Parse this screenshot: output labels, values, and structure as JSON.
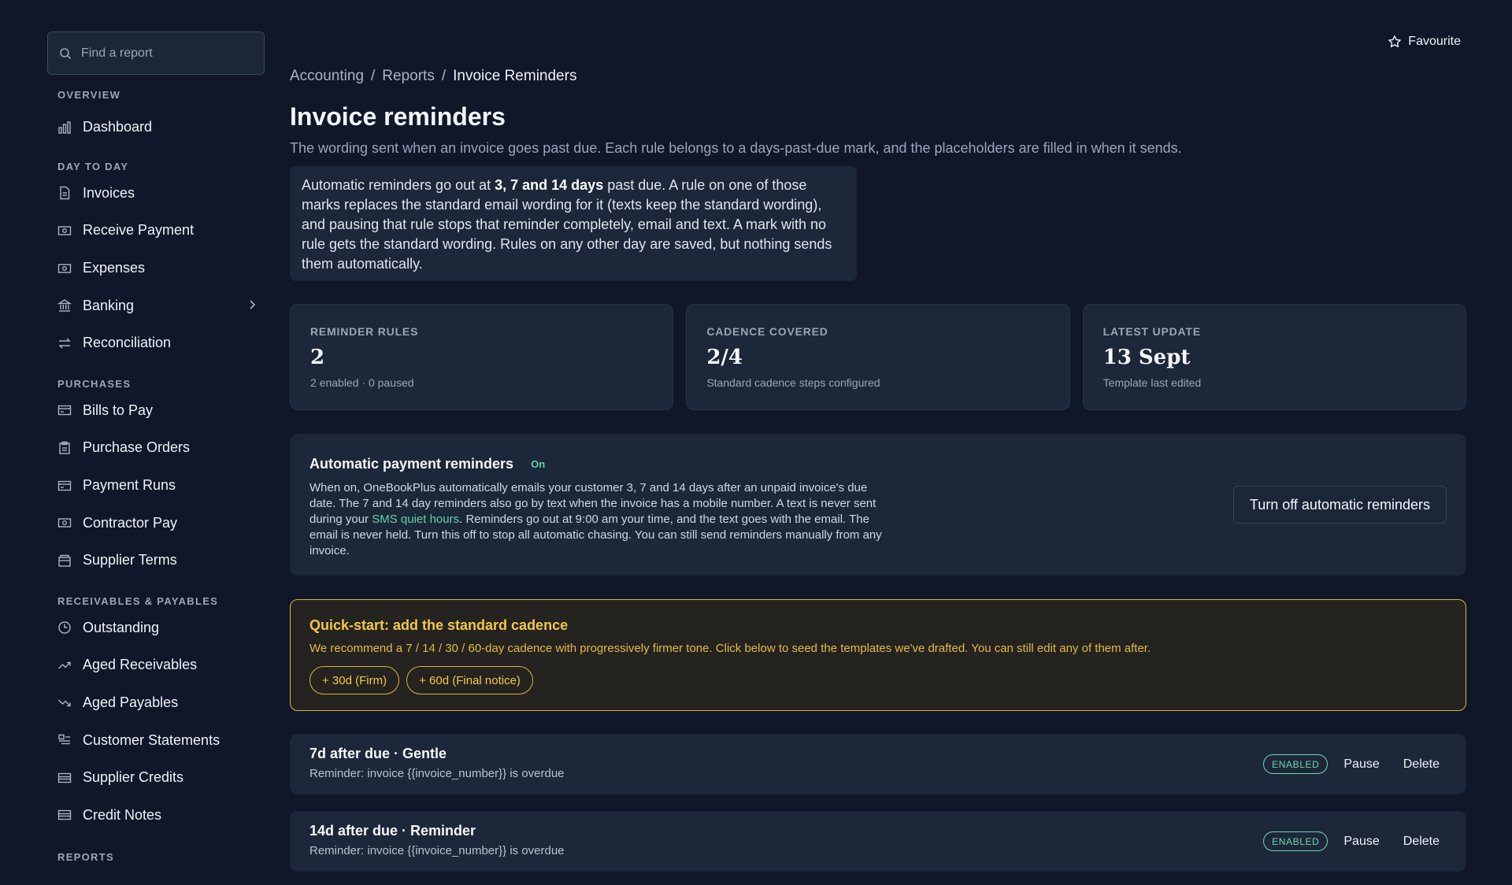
{
  "sidebar": {
    "search_placeholder": "Find a report",
    "sections": [
      {
        "label": "OVERVIEW",
        "items": [
          {
            "label": "Dashboard",
            "icon": "bar-chart-icon"
          }
        ]
      },
      {
        "label": "DAY TO DAY",
        "items": [
          {
            "label": "Invoices",
            "icon": "document-icon"
          },
          {
            "label": "Receive Payment",
            "icon": "banknote-icon"
          },
          {
            "label": "Expenses",
            "icon": "banknote-icon"
          },
          {
            "label": "Banking",
            "icon": "bank-icon",
            "has_submenu": true
          },
          {
            "label": "Reconciliation",
            "icon": "arrows-swap-icon"
          }
        ]
      },
      {
        "label": "PURCHASES",
        "items": [
          {
            "label": "Bills to Pay",
            "icon": "card-icon"
          },
          {
            "label": "Purchase Orders",
            "icon": "clipboard-icon"
          },
          {
            "label": "Payment Runs",
            "icon": "card-icon"
          },
          {
            "label": "Contractor Pay",
            "icon": "banknote-icon"
          },
          {
            "label": "Supplier Terms",
            "icon": "folder-icon"
          }
        ]
      },
      {
        "label": "RECEIVABLES & PAYABLES",
        "items": [
          {
            "label": "Outstanding",
            "icon": "clock-icon"
          },
          {
            "label": "Aged Receivables",
            "icon": "trend-up-icon"
          },
          {
            "label": "Aged Payables",
            "icon": "trend-down-icon"
          },
          {
            "label": "Customer Statements",
            "icon": "statement-icon"
          },
          {
            "label": "Supplier Credits",
            "icon": "list-icon"
          },
          {
            "label": "Credit Notes",
            "icon": "list-icon"
          }
        ]
      },
      {
        "label": "REPORTS",
        "items": []
      }
    ]
  },
  "header": {
    "favourite_label": "Favourite",
    "breadcrumbs": [
      "Accounting",
      "Reports",
      "Invoice Reminders"
    ],
    "separator": "/",
    "title": "Invoice reminders",
    "subtitle": "The wording sent when an invoice goes past due. Each rule belongs to a days-past-due mark, and the placeholders are filled in when it sends."
  },
  "info": {
    "prefix": "Automatic reminders go out at ",
    "bold": "3, 7 and 14 days",
    "suffix": " past due. A rule on one of those marks replaces the standard email wording for it (texts keep the standard wording), and pausing that rule stops that reminder completely, email and text. A mark with no rule gets the standard wording. Rules on any other day are saved, but nothing sends them automatically."
  },
  "stats": [
    {
      "label": "REMINDER RULES",
      "value": "2",
      "note": "2 enabled · 0 paused"
    },
    {
      "label": "CADENCE COVERED",
      "value": "2/4",
      "note": "Standard cadence steps configured"
    },
    {
      "label": "LATEST UPDATE",
      "value": "13 Sept",
      "note": "Template last edited"
    }
  ],
  "auto": {
    "title": "Automatic payment reminders",
    "status": "On",
    "desc_a": "When on, OneBookPlus automatically emails your customer 3, 7 and 14 days after an unpaid invoice's due date. The 7 and 14 day reminders also go by text when the invoice has a mobile number. A text is never sent during your ",
    "desc_link": "SMS quiet hours",
    "desc_b": ". Reminders go out at 9:00 am your time, and the text goes with the email. The email is never held. Turn this off to stop all automatic chasing. You can still send reminders manually from any invoice.",
    "button": "Turn off automatic reminders"
  },
  "quick": {
    "title": "Quick-start: add the standard cadence",
    "desc": "We recommend a 7 / 14 / 30 / 60-day cadence with progressively firmer tone. Click below to seed the templates we've drafted. You can still edit any of them after.",
    "chips": [
      "+ 30d (Firm)",
      "+ 60d (Final notice)"
    ]
  },
  "rules": [
    {
      "title": "7d after due · Gentle",
      "subject": "Reminder: invoice {{invoice_number}} is overdue",
      "badge": "ENABLED",
      "pause": "Pause",
      "delete": "Delete"
    },
    {
      "title": "14d after due · Reminder",
      "subject": "Reminder: invoice {{invoice_number}} is overdue",
      "badge": "ENABLED",
      "pause": "Pause",
      "delete": "Delete"
    }
  ]
}
